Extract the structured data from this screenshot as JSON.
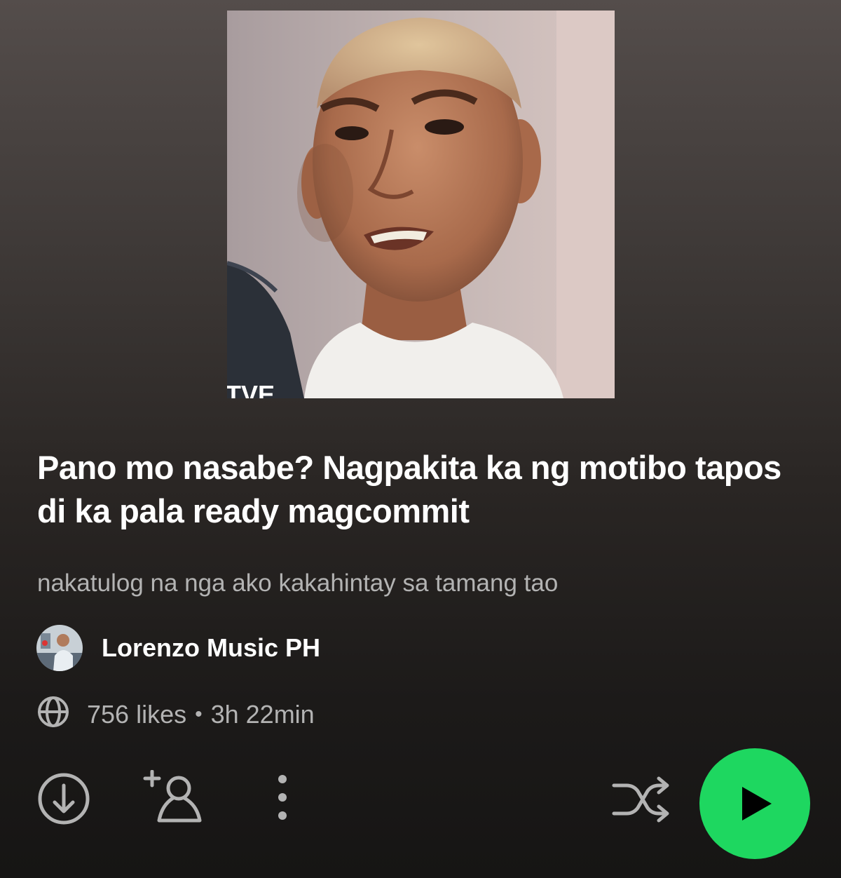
{
  "playlist": {
    "title": "Pano mo nasabe? Nagpakita ka ng motibo tapos di ka pala ready magcommit",
    "description": "nakatulog na nga ako kakahintay sa tamang tao",
    "owner_name": "Lorenzo Music PH",
    "likes": "756 likes",
    "separator": "•",
    "duration": "3h 22min",
    "cover_caption": "TVE"
  },
  "icons": {
    "visibility": "globe-icon",
    "download": "download-icon",
    "add_collaborator": "add-user-icon",
    "more": "more-options-icon",
    "shuffle": "shuffle-icon",
    "play": "play-icon"
  },
  "colors": {
    "accent": "#1ed760",
    "secondary_text": "#b3b3b3",
    "background_top": "#544d4b",
    "background_bottom": "#161514"
  }
}
